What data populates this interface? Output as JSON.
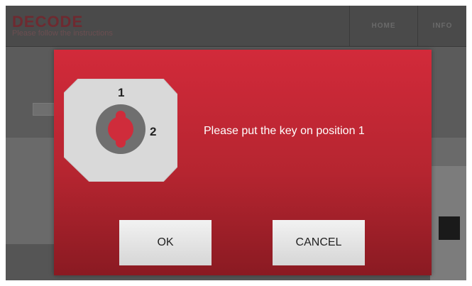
{
  "header": {
    "title": "DECODE",
    "subtitle": "Please follow the instructions",
    "nav": [
      {
        "label": "HOME"
      },
      {
        "label": "INFO"
      }
    ]
  },
  "dialog": {
    "key_graphic": {
      "position_1_label": "1",
      "position_2_label": "2",
      "icon": "key-slot-icon"
    },
    "message": "Please put the key on position 1",
    "ok_label": "OK",
    "cancel_label": "CANCEL"
  },
  "colors": {
    "dialog_red": "#c8283a",
    "overlay_gray": "#5b5b5b",
    "title_dim_red": "#6e2a30"
  }
}
